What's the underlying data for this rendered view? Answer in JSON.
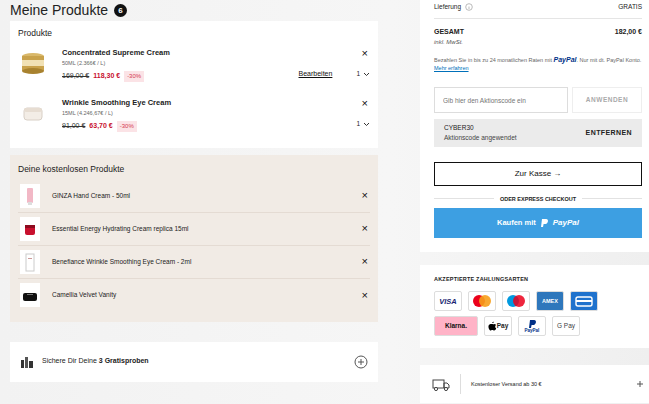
{
  "cart": {
    "title": "Meine Produkte",
    "count": "6"
  },
  "products": {
    "heading": "Produkte",
    "items": [
      {
        "name": "Concentrated Supreme Cream",
        "size": "50ML (2.366€ / L)",
        "old_price": "169,00 €",
        "price": "118,30 €",
        "discount": "-30%",
        "edit": "Bearbeiten",
        "qty": "1",
        "remove": "×"
      },
      {
        "name": "Wrinkle Smoothing Eye Cream",
        "size": "15ML (4.246,67€ / L)",
        "old_price": "91,00 €",
        "price": "63,70 €",
        "discount": "-30%",
        "qty": "1",
        "remove": "×"
      }
    ]
  },
  "free": {
    "heading": "Deine kostenlosen Produkte",
    "items": [
      {
        "name": "GINZA Hand Cream - 50ml",
        "remove": "×"
      },
      {
        "name": "Essential Energy Hydrating Cream replica 15ml",
        "remove": "×"
      },
      {
        "name": "Benefiance Wrinkle Smoothing Eye Cream - 2ml",
        "remove": "×"
      },
      {
        "name": "Camellia Velvet Vanity",
        "remove": "×"
      }
    ]
  },
  "samples": {
    "text": "Sichere Dir Deine ",
    "bold": "3 Gratisproben"
  },
  "summary": {
    "delivery_label": "Lieferung",
    "delivery_value": "GRATIS",
    "total_label": "GESAMT",
    "total_value": "182,00 €",
    "tax_note": "inkl. MwSt.",
    "installment_text": "Bezahlen Sie in bis zu 24 monatlichen Raten mit ",
    "installment_brand": "PayPal",
    "installment_after": ". Nur mit dt. PayPal Konto. ",
    "installment_link": "Mehr erfahren",
    "promo_placeholder": "Gib hier den Aktionscode ein",
    "apply_button": "ANWENDEN",
    "applied_code": "CYBER30",
    "applied_note": "Aktionscode angewendet",
    "remove_code": "ENTFERNEN",
    "checkout_button": "Zur Kasse →",
    "express_label": "ODER EXPRESS CHECKOUT",
    "paypal_button_text": "Kaufen mit",
    "paypal_button_brand": "PayPal"
  },
  "payments": {
    "heading": "AKZEPTIERTE ZAHLUNGSARTEN",
    "methods": [
      {
        "kind": "visa",
        "label": "VISA"
      },
      {
        "kind": "mastercard"
      },
      {
        "kind": "maestro"
      },
      {
        "kind": "amex",
        "label": "AMEX"
      },
      {
        "kind": "card"
      },
      {
        "kind": "klarna",
        "label": "Klarna."
      },
      {
        "kind": "applepay",
        "label": "Pay"
      },
      {
        "kind": "paypal",
        "label": "PayPal"
      },
      {
        "kind": "gpay",
        "label": "G Pay"
      }
    ]
  },
  "shipping": {
    "label": "Kostenloser Versand ab 30 €"
  }
}
